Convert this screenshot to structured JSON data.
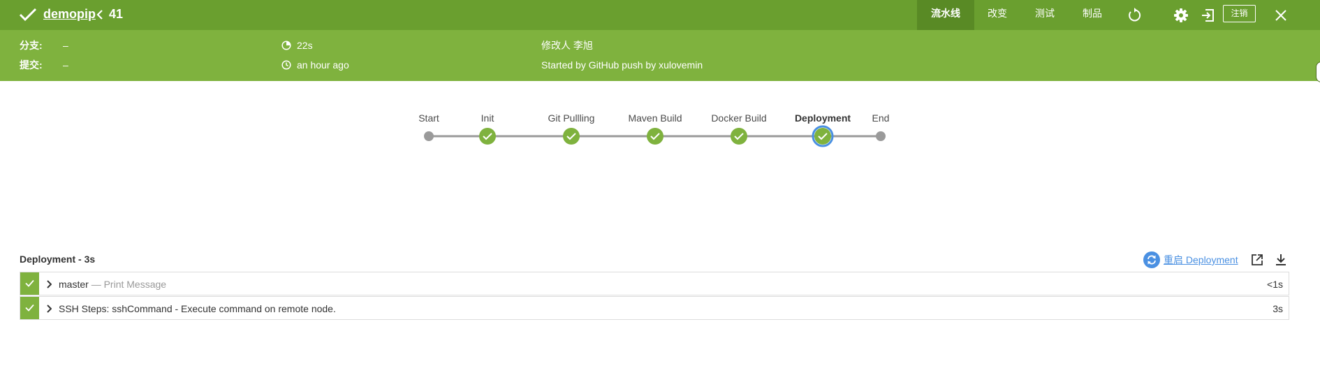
{
  "header": {
    "pipeline_name": "demopip",
    "run_number": "41",
    "tabs": [
      {
        "label": "流水线",
        "active": true
      },
      {
        "label": "改变",
        "active": false
      },
      {
        "label": "测试",
        "active": false
      },
      {
        "label": "制品",
        "active": false
      }
    ],
    "icons": [
      "check-icon",
      "chevron-left-icon",
      "replay-icon",
      "gear-icon",
      "exit-icon",
      "close-icon"
    ],
    "logout_label": "注销"
  },
  "run_info": {
    "branch_label": "分支:",
    "branch_value": "–",
    "commit_label": "提交:",
    "commit_value": "–",
    "duration": "22s",
    "started_ago": "an hour ago",
    "changes_by": "修改人 李旭",
    "cause": "Started by GitHub push by xulovemin"
  },
  "graph": {
    "stages": [
      {
        "name": "Start",
        "status": "start"
      },
      {
        "name": "Init",
        "status": "success"
      },
      {
        "name": "Git Pullling",
        "status": "success"
      },
      {
        "name": "Maven Build",
        "status": "success"
      },
      {
        "name": "Docker Build",
        "status": "success"
      },
      {
        "name": "Deployment",
        "status": "success",
        "selected": true
      },
      {
        "name": "End",
        "status": "end"
      }
    ]
  },
  "steps": {
    "title": "Deployment - 3s",
    "restart_label": "重启 Deployment",
    "rows": [
      {
        "name": "master",
        "detail": "— Print Message",
        "duration": "<1s"
      },
      {
        "name": "SSH Steps: sshCommand - Execute command on remote node.",
        "detail": "",
        "duration": "3s"
      }
    ]
  },
  "colors": {
    "topbar": "#6a9f2f",
    "active_tab": "#598a25",
    "infobar": "#7fb23e",
    "success": "#7fb23e",
    "selected_ring": "#4a90e2",
    "link": "#4a90e2"
  }
}
